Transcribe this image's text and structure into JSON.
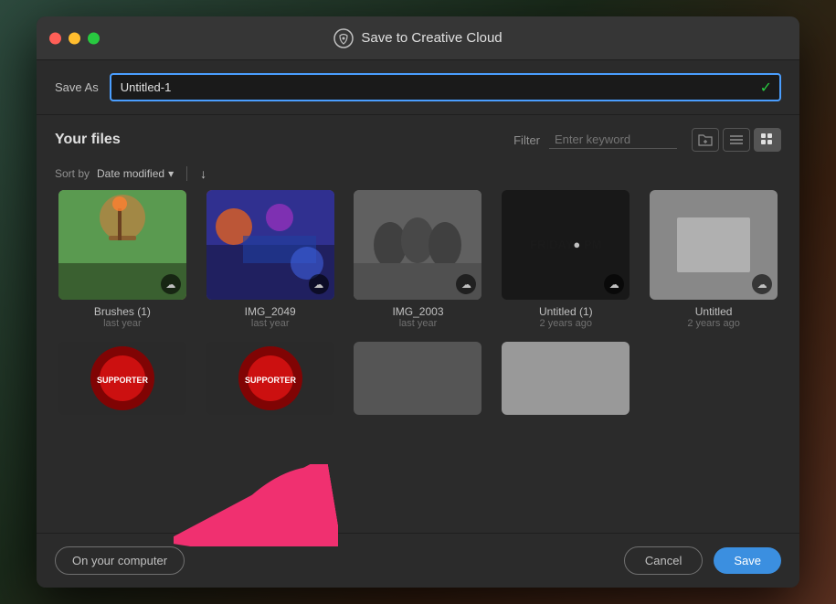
{
  "window": {
    "title": "Save to Creative Cloud",
    "traffic_lights": [
      "close",
      "minimize",
      "maximize"
    ]
  },
  "save_as": {
    "label": "Save As",
    "value": "Untitled-1",
    "placeholder": "Untitled-1"
  },
  "files_section": {
    "title": "Your files",
    "filter_label": "Filter",
    "filter_placeholder": "Enter keyword",
    "sort_label": "Sort by",
    "sort_value": "Date modified",
    "sort_arrow": "↓"
  },
  "files": [
    {
      "name": "Brushes (1)",
      "date": "last year",
      "thumb_type": "brushes"
    },
    {
      "name": "IMG_2049",
      "date": "last year",
      "thumb_type": "img2049"
    },
    {
      "name": "IMG_2003",
      "date": "last year",
      "thumb_type": "img2003"
    },
    {
      "name": "Untitled (1)",
      "date": "2 years ago",
      "thumb_type": "untitled1"
    },
    {
      "name": "Untitled",
      "date": "2 years ago",
      "thumb_type": "untitled"
    },
    {
      "name": "",
      "date": "",
      "thumb_type": "red-badge"
    },
    {
      "name": "",
      "date": "",
      "thumb_type": "red-badge2"
    },
    {
      "name": "",
      "date": "",
      "thumb_type": "gray"
    },
    {
      "name": "",
      "date": "",
      "thumb_type": "light-gray"
    }
  ],
  "buttons": {
    "on_computer": "On your computer",
    "cancel": "Cancel",
    "save": "Save"
  },
  "icons": {
    "cc_logo": "⊙",
    "cloud": "☁",
    "checkmark": "✓",
    "sort_down": "↓",
    "chevron_down": "▾",
    "list_view": "≡",
    "grid_view": "⊞",
    "folder_add": "⊕"
  }
}
